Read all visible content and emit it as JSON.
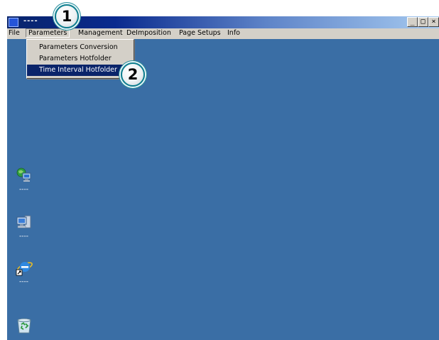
{
  "window": {
    "title": "----",
    "buttons": {
      "minimize": "_",
      "maximize": "□",
      "close": "×"
    }
  },
  "menubar": {
    "items": [
      {
        "label": "File"
      },
      {
        "label": "Parameters"
      },
      {
        "label": "Management"
      },
      {
        "label": "DeImposition"
      },
      {
        "label": "Page Setups"
      },
      {
        "label": "Info"
      }
    ]
  },
  "dropdown": {
    "items": [
      {
        "label": "Parameters Conversion"
      },
      {
        "label": "Parameters Hotfolder"
      },
      {
        "label": "Time Interval Hotfolder"
      }
    ],
    "selected_index": 2
  },
  "desktop": {
    "background": "#3a6ea5",
    "icons": [
      {
        "icon": "network-globe-icon",
        "label": "----"
      },
      {
        "icon": "my-computer-icon",
        "label": "----"
      },
      {
        "icon": "internet-explorer-icon",
        "label": "----"
      },
      {
        "icon": "recycle-bin-icon",
        "label": ""
      }
    ]
  },
  "callouts": [
    {
      "number": "1"
    },
    {
      "number": "2"
    }
  ]
}
